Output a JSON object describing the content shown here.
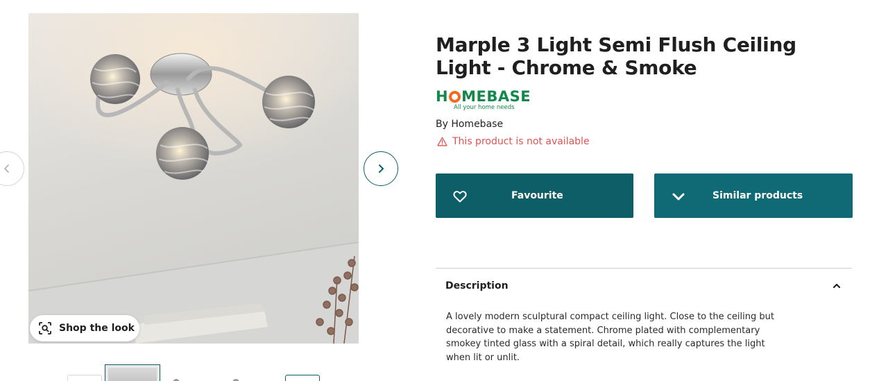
{
  "gallery": {
    "shop_the_look_label": "Shop the look",
    "prev_arrow": "‹",
    "next_arrow": "›",
    "thumbnail_count": 5
  },
  "product": {
    "title": "Marple 3 Light Semi Flush Ceiling Light - Chrome & Smoke",
    "brand_logo": {
      "word_pre": "H",
      "word_post": "MEBASE",
      "tagline": "All your home needs",
      "green": "#13884a",
      "orange": "#f36a21"
    },
    "by_line": "By Homebase",
    "availability": "This product is not available"
  },
  "actions": {
    "favourite_label": "Favourite",
    "similar_label": "Similar products"
  },
  "description": {
    "heading": "Description",
    "expanded": true,
    "body": "A lovely modern sculptural compact ceiling light. Close to the ceiling but decorative to make a statement. Chrome plated with complementary smokey tinted glass with a spiral detail, which really captures the light when lit or unlit."
  },
  "colors": {
    "primary_button": "#0e5e67",
    "secondary_button": "#0f6a76",
    "error_text": "#e05252",
    "heading_text": "#1f1f1f"
  }
}
